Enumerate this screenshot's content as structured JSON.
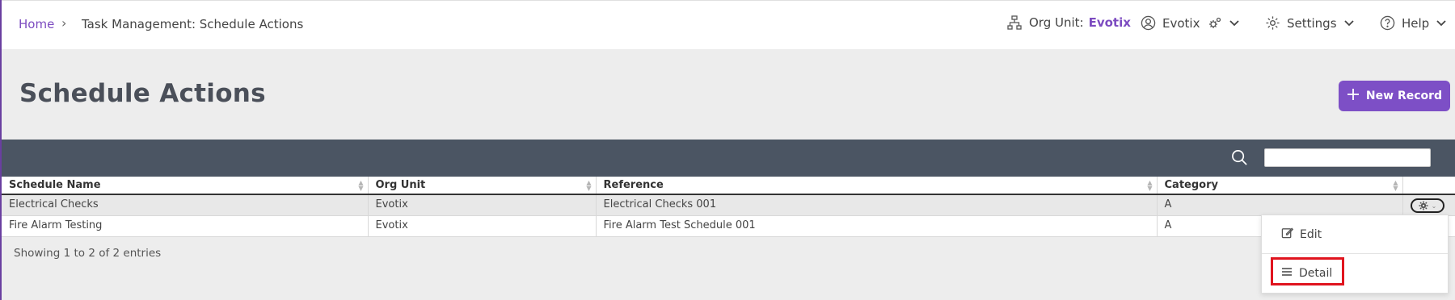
{
  "breadcrumb": {
    "home": "Home",
    "current": "Task Management: Schedule Actions"
  },
  "topnav": {
    "org_label": "Org Unit:",
    "org_value": "Evotix",
    "user_name": "Evotix",
    "settings_label": "Settings",
    "help_label": "Help"
  },
  "page": {
    "title": "Schedule Actions",
    "new_record_label": "New Record"
  },
  "table": {
    "columns": [
      "Schedule Name",
      "Org Unit",
      "Reference",
      "Category"
    ],
    "rows": [
      [
        "Electrical Checks",
        "Evotix",
        "Electrical Checks 001",
        "A"
      ],
      [
        "Fire Alarm Testing",
        "Evotix",
        "Fire Alarm Test Schedule 001",
        "A"
      ]
    ],
    "footer": "Showing 1 to 2 of 2 entries"
  },
  "row_menu": {
    "edit_label": "Edit",
    "detail_label": "Detail"
  },
  "colors": {
    "accent": "#7d4fc6",
    "toolbar": "#4b5563",
    "highlight": "#e0141e"
  }
}
